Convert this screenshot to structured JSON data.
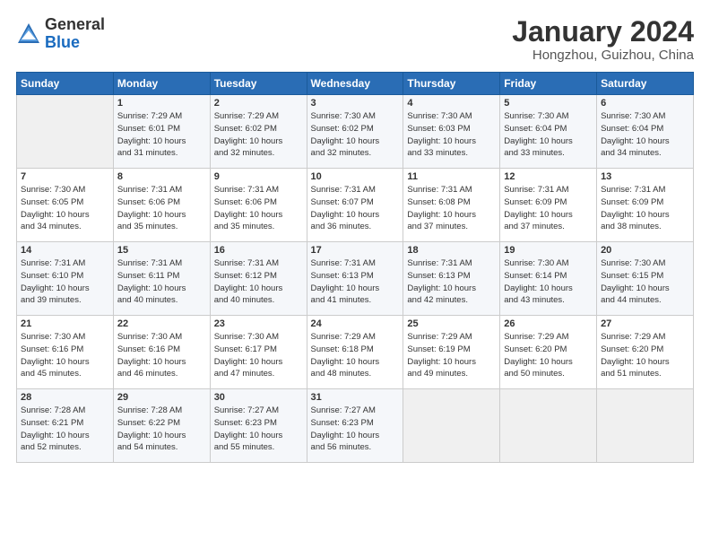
{
  "header": {
    "logo_general": "General",
    "logo_blue": "Blue",
    "month_title": "January 2024",
    "location": "Hongzhou, Guizhou, China"
  },
  "days_of_week": [
    "Sunday",
    "Monday",
    "Tuesday",
    "Wednesday",
    "Thursday",
    "Friday",
    "Saturday"
  ],
  "weeks": [
    [
      {
        "day": "",
        "sunrise": "",
        "sunset": "",
        "daylight": ""
      },
      {
        "day": "1",
        "sunrise": "Sunrise: 7:29 AM",
        "sunset": "Sunset: 6:01 PM",
        "daylight": "Daylight: 10 hours and 31 minutes."
      },
      {
        "day": "2",
        "sunrise": "Sunrise: 7:29 AM",
        "sunset": "Sunset: 6:02 PM",
        "daylight": "Daylight: 10 hours and 32 minutes."
      },
      {
        "day": "3",
        "sunrise": "Sunrise: 7:30 AM",
        "sunset": "Sunset: 6:02 PM",
        "daylight": "Daylight: 10 hours and 32 minutes."
      },
      {
        "day": "4",
        "sunrise": "Sunrise: 7:30 AM",
        "sunset": "Sunset: 6:03 PM",
        "daylight": "Daylight: 10 hours and 33 minutes."
      },
      {
        "day": "5",
        "sunrise": "Sunrise: 7:30 AM",
        "sunset": "Sunset: 6:04 PM",
        "daylight": "Daylight: 10 hours and 33 minutes."
      },
      {
        "day": "6",
        "sunrise": "Sunrise: 7:30 AM",
        "sunset": "Sunset: 6:04 PM",
        "daylight": "Daylight: 10 hours and 34 minutes."
      }
    ],
    [
      {
        "day": "7",
        "sunrise": "Sunrise: 7:30 AM",
        "sunset": "Sunset: 6:05 PM",
        "daylight": "Daylight: 10 hours and 34 minutes."
      },
      {
        "day": "8",
        "sunrise": "Sunrise: 7:31 AM",
        "sunset": "Sunset: 6:06 PM",
        "daylight": "Daylight: 10 hours and 35 minutes."
      },
      {
        "day": "9",
        "sunrise": "Sunrise: 7:31 AM",
        "sunset": "Sunset: 6:06 PM",
        "daylight": "Daylight: 10 hours and 35 minutes."
      },
      {
        "day": "10",
        "sunrise": "Sunrise: 7:31 AM",
        "sunset": "Sunset: 6:07 PM",
        "daylight": "Daylight: 10 hours and 36 minutes."
      },
      {
        "day": "11",
        "sunrise": "Sunrise: 7:31 AM",
        "sunset": "Sunset: 6:08 PM",
        "daylight": "Daylight: 10 hours and 37 minutes."
      },
      {
        "day": "12",
        "sunrise": "Sunrise: 7:31 AM",
        "sunset": "Sunset: 6:09 PM",
        "daylight": "Daylight: 10 hours and 37 minutes."
      },
      {
        "day": "13",
        "sunrise": "Sunrise: 7:31 AM",
        "sunset": "Sunset: 6:09 PM",
        "daylight": "Daylight: 10 hours and 38 minutes."
      }
    ],
    [
      {
        "day": "14",
        "sunrise": "Sunrise: 7:31 AM",
        "sunset": "Sunset: 6:10 PM",
        "daylight": "Daylight: 10 hours and 39 minutes."
      },
      {
        "day": "15",
        "sunrise": "Sunrise: 7:31 AM",
        "sunset": "Sunset: 6:11 PM",
        "daylight": "Daylight: 10 hours and 40 minutes."
      },
      {
        "day": "16",
        "sunrise": "Sunrise: 7:31 AM",
        "sunset": "Sunset: 6:12 PM",
        "daylight": "Daylight: 10 hours and 40 minutes."
      },
      {
        "day": "17",
        "sunrise": "Sunrise: 7:31 AM",
        "sunset": "Sunset: 6:13 PM",
        "daylight": "Daylight: 10 hours and 41 minutes."
      },
      {
        "day": "18",
        "sunrise": "Sunrise: 7:31 AM",
        "sunset": "Sunset: 6:13 PM",
        "daylight": "Daylight: 10 hours and 42 minutes."
      },
      {
        "day": "19",
        "sunrise": "Sunrise: 7:30 AM",
        "sunset": "Sunset: 6:14 PM",
        "daylight": "Daylight: 10 hours and 43 minutes."
      },
      {
        "day": "20",
        "sunrise": "Sunrise: 7:30 AM",
        "sunset": "Sunset: 6:15 PM",
        "daylight": "Daylight: 10 hours and 44 minutes."
      }
    ],
    [
      {
        "day": "21",
        "sunrise": "Sunrise: 7:30 AM",
        "sunset": "Sunset: 6:16 PM",
        "daylight": "Daylight: 10 hours and 45 minutes."
      },
      {
        "day": "22",
        "sunrise": "Sunrise: 7:30 AM",
        "sunset": "Sunset: 6:16 PM",
        "daylight": "Daylight: 10 hours and 46 minutes."
      },
      {
        "day": "23",
        "sunrise": "Sunrise: 7:30 AM",
        "sunset": "Sunset: 6:17 PM",
        "daylight": "Daylight: 10 hours and 47 minutes."
      },
      {
        "day": "24",
        "sunrise": "Sunrise: 7:29 AM",
        "sunset": "Sunset: 6:18 PM",
        "daylight": "Daylight: 10 hours and 48 minutes."
      },
      {
        "day": "25",
        "sunrise": "Sunrise: 7:29 AM",
        "sunset": "Sunset: 6:19 PM",
        "daylight": "Daylight: 10 hours and 49 minutes."
      },
      {
        "day": "26",
        "sunrise": "Sunrise: 7:29 AM",
        "sunset": "Sunset: 6:20 PM",
        "daylight": "Daylight: 10 hours and 50 minutes."
      },
      {
        "day": "27",
        "sunrise": "Sunrise: 7:29 AM",
        "sunset": "Sunset: 6:20 PM",
        "daylight": "Daylight: 10 hours and 51 minutes."
      }
    ],
    [
      {
        "day": "28",
        "sunrise": "Sunrise: 7:28 AM",
        "sunset": "Sunset: 6:21 PM",
        "daylight": "Daylight: 10 hours and 52 minutes."
      },
      {
        "day": "29",
        "sunrise": "Sunrise: 7:28 AM",
        "sunset": "Sunset: 6:22 PM",
        "daylight": "Daylight: 10 hours and 54 minutes."
      },
      {
        "day": "30",
        "sunrise": "Sunrise: 7:27 AM",
        "sunset": "Sunset: 6:23 PM",
        "daylight": "Daylight: 10 hours and 55 minutes."
      },
      {
        "day": "31",
        "sunrise": "Sunrise: 7:27 AM",
        "sunset": "Sunset: 6:23 PM",
        "daylight": "Daylight: 10 hours and 56 minutes."
      },
      {
        "day": "",
        "sunrise": "",
        "sunset": "",
        "daylight": ""
      },
      {
        "day": "",
        "sunrise": "",
        "sunset": "",
        "daylight": ""
      },
      {
        "day": "",
        "sunrise": "",
        "sunset": "",
        "daylight": ""
      }
    ]
  ]
}
